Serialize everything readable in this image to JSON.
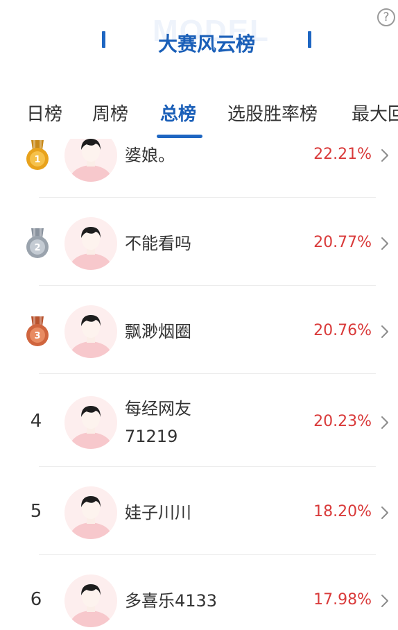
{
  "header": {
    "watermark": "MODEL",
    "title": "大赛风云榜",
    "help_glyph": "?"
  },
  "tabs": [
    {
      "label": "日榜",
      "active": false
    },
    {
      "label": "周榜",
      "active": false
    },
    {
      "label": "总榜",
      "active": true
    },
    {
      "label": "选股胜率榜",
      "active": false
    },
    {
      "label": "最大回",
      "active": false
    }
  ],
  "colors": {
    "accent": "#1e66c2",
    "percent": "#d93a3a",
    "gold": "#e8a21c",
    "silver": "#9aa3ad",
    "bronze": "#d0653e"
  },
  "rankings": [
    {
      "rank": "1",
      "medal": "gold",
      "name_lines": [
        "婆娘。"
      ],
      "percent": "22.21%"
    },
    {
      "rank": "2",
      "medal": "silver",
      "name_lines": [
        "不能看吗"
      ],
      "percent": "20.77%"
    },
    {
      "rank": "3",
      "medal": "bronze",
      "name_lines": [
        "飘渺烟圈"
      ],
      "percent": "20.76%"
    },
    {
      "rank": "4",
      "medal": null,
      "name_lines": [
        "每经网友",
        "71219"
      ],
      "percent": "20.23%"
    },
    {
      "rank": "5",
      "medal": null,
      "name_lines": [
        "娃子川川"
      ],
      "percent": "18.20%"
    },
    {
      "rank": "6",
      "medal": null,
      "name_lines": [
        "多喜乐4133"
      ],
      "percent": "17.98%"
    }
  ]
}
